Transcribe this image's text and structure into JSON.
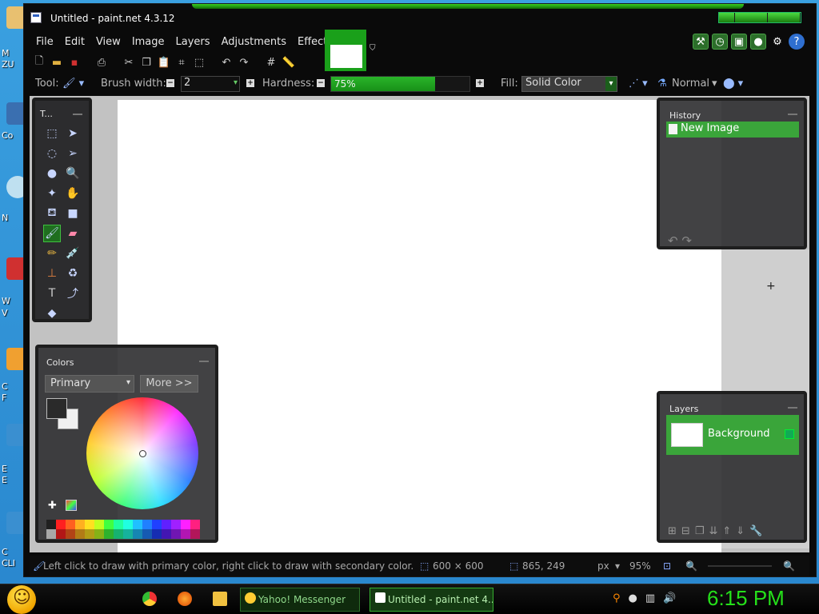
{
  "window": {
    "title": "Untitled - paint.net 4.3.12"
  },
  "menu": [
    "File",
    "Edit",
    "View",
    "Image",
    "Layers",
    "Adjustments",
    "Effects"
  ],
  "toolbar": {
    "tool_label": "Tool:",
    "brush_width_label": "Brush width:",
    "brush_width_value": "2",
    "hardness_label": "Hardness:",
    "hardness_value": "75%",
    "hardness_fraction": 0.75,
    "fill_label": "Fill:",
    "fill_value": "Solid Color",
    "blend_mode": "Normal"
  },
  "panels": {
    "tools_title": "T...",
    "history_title": "History",
    "history_item": "New Image",
    "colors_title": "Colors",
    "color_mode": "Primary",
    "more_button": "More >>",
    "layers_title": "Layers",
    "layer_name": "Background"
  },
  "status": {
    "hint": "Left click to draw with primary color, right click to draw with secondary color.",
    "image_size": "600 × 600",
    "cursor_pos": "865, 249",
    "units": "px",
    "zoom": "95%"
  },
  "desktop_labels": [
    "M",
    "ZU",
    "Co",
    "N",
    "W",
    "V",
    "C",
    "F",
    "E",
    "E",
    "C",
    "CLI"
  ],
  "taskbar": {
    "messenger": "Yahoo! Messenger",
    "paintnet": "Untitled - paint.net 4....",
    "clock": "6:15 PM"
  },
  "colors": {
    "accent": "#1aa01a",
    "primary": "#2a2a2a",
    "secondary": "#f0f0f0",
    "palette": [
      "#202020",
      "#ff2020",
      "#ff6020",
      "#ffb020",
      "#ffe020",
      "#c0ff20",
      "#40ff40",
      "#20ffa0",
      "#20ffe0",
      "#20c0ff",
      "#2080ff",
      "#2040ff",
      "#6020ff",
      "#a020ff",
      "#ff20ff",
      "#ff2080"
    ]
  }
}
